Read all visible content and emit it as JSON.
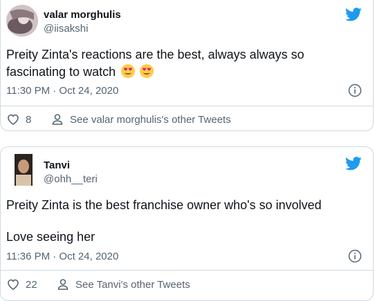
{
  "tweets": [
    {
      "author_name": "valar morghulis",
      "handle": "@iisakshi",
      "text": "Preity Zinta's reactions are the best, always always so fascinating to watch",
      "emoji": "heart-eyes-emoji",
      "timestamp": "11:30 PM · Oct 24, 2020",
      "like_count": "8",
      "other_tweets_link": "See valar morghulis's other Tweets"
    },
    {
      "author_name": "Tanvi",
      "handle": "@ohh__teri",
      "text_line1": "Preity Zinta is the best franchise owner who's so involved",
      "text_line2": "Love seeing her",
      "timestamp": "11:36 PM · Oct 24, 2020",
      "like_count": "22",
      "other_tweets_link": "See Tanvi's other Tweets"
    }
  ],
  "colors": {
    "twitter_blue": "#1d9bf0",
    "text_primary": "#0f1419",
    "text_secondary": "#536471",
    "border": "#cfd9de"
  },
  "icons": [
    "twitter-bird-icon",
    "info-icon",
    "heart-icon",
    "person-icon"
  ]
}
